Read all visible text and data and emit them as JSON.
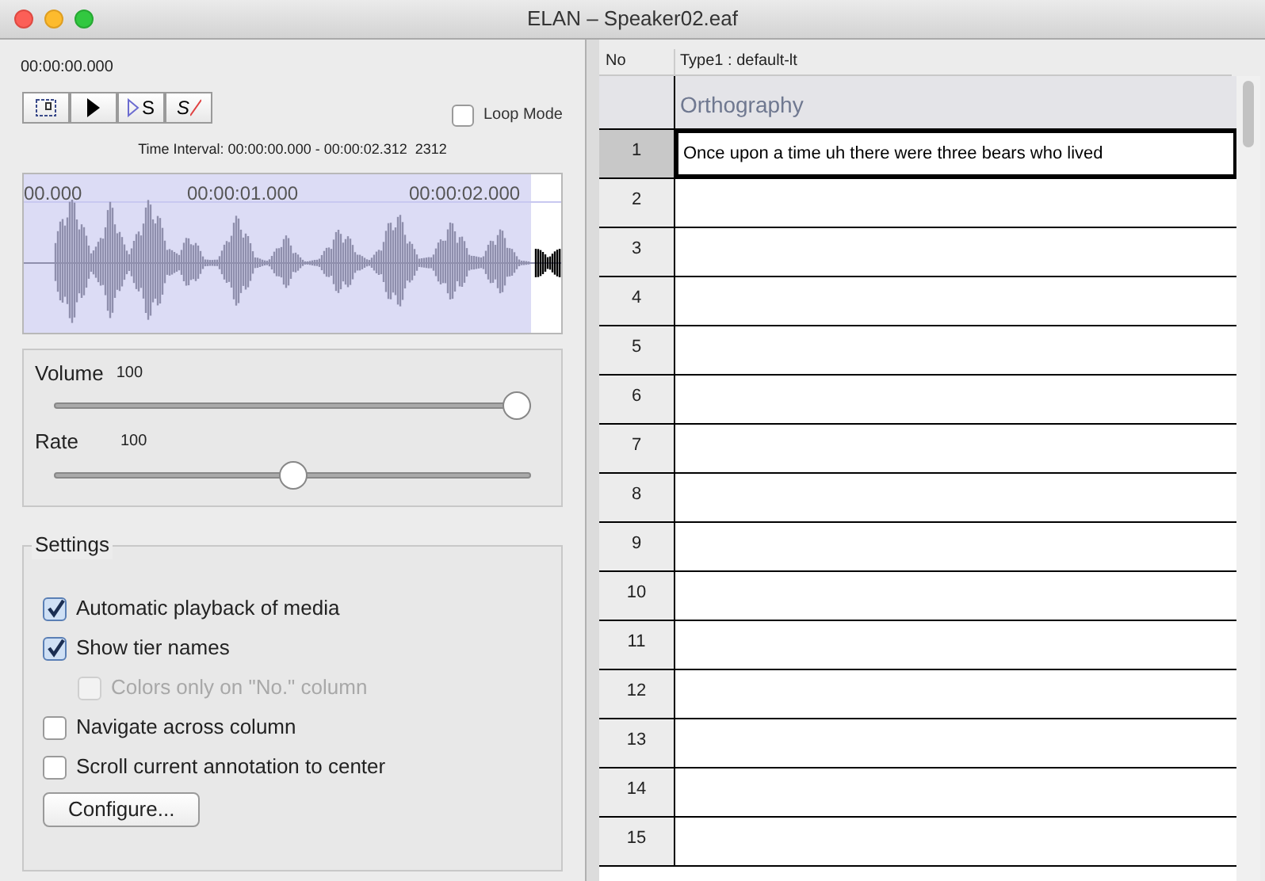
{
  "window": {
    "title": "ELAN – Speaker02.eaf"
  },
  "media": {
    "time": "00:00:00.000",
    "buttons": [
      {
        "kind": "selection"
      },
      {
        "kind": "play"
      },
      {
        "kind": "play-selection",
        "label": "S"
      },
      {
        "kind": "clear-selection",
        "label": "S"
      }
    ],
    "loop_mode": {
      "label": "Loop Mode",
      "checked": false
    },
    "time_interval": "Time Interval: 00:00:00.000 - 00:00:02.312  2312",
    "ruler": [
      "00.000",
      "00:00:01.000",
      "00:00:02.000"
    ]
  },
  "sliders": [
    {
      "label": "Volume",
      "reading": "100",
      "level": 1
    },
    {
      "label": "Rate",
      "reading": "100",
      "level": 0.5
    }
  ],
  "settings": {
    "title": "Settings",
    "options": [
      {
        "label": "Automatic playback of media",
        "checked": true,
        "disabled": false
      },
      {
        "label": "Show tier names",
        "checked": true,
        "disabled": false,
        "children": [
          {
            "label": "Colors only on \"No.\" column",
            "checked": false,
            "disabled": true
          }
        ]
      },
      {
        "label": "Navigate across column",
        "checked": false,
        "disabled": false
      },
      {
        "label": "Scroll current annotation to center",
        "checked": false,
        "disabled": false
      }
    ],
    "button": "Configure..."
  },
  "table": {
    "columns": [
      "No",
      "Type1 : default-lt"
    ],
    "tier": "Orthography",
    "rows": [
      {
        "number": "1",
        "text": "Once upon a time uh there were three bears who lived",
        "selected": true
      },
      {
        "number": "2",
        "selected": false
      },
      {
        "number": "3",
        "selected": false
      },
      {
        "number": "4",
        "selected": false
      },
      {
        "number": "5",
        "selected": false
      },
      {
        "number": "6",
        "selected": false
      },
      {
        "number": "7",
        "selected": false
      },
      {
        "number": "8",
        "selected": false
      },
      {
        "number": "9",
        "selected": false
      },
      {
        "number": "10",
        "selected": false
      },
      {
        "number": "11",
        "selected": false
      },
      {
        "number": "12",
        "selected": false
      },
      {
        "number": "13",
        "selected": false
      },
      {
        "number": "14",
        "selected": false
      },
      {
        "number": "15",
        "selected": false
      }
    ]
  }
}
